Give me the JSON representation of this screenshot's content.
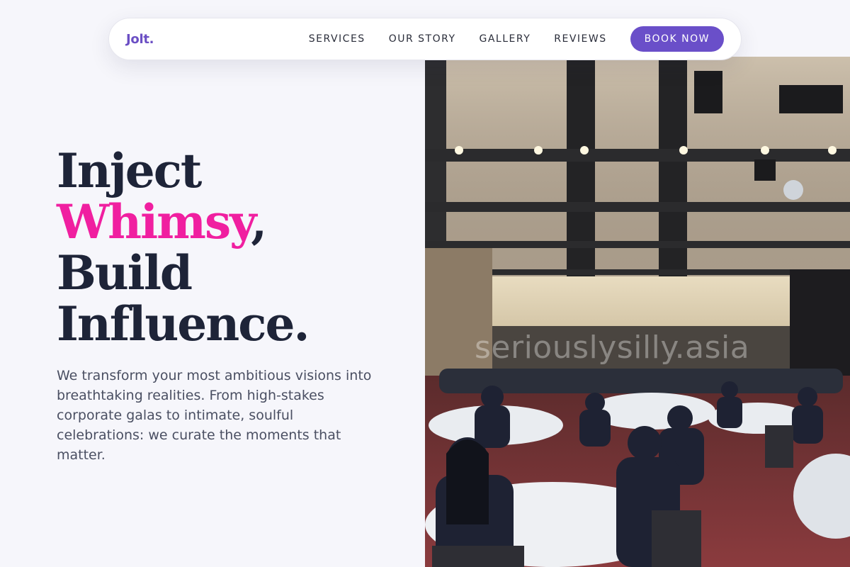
{
  "nav": {
    "brand": "Jolt.",
    "links": [
      "SERVICES",
      "OUR STORY",
      "GALLERY",
      "REVIEWS"
    ],
    "cta": "BOOK NOW"
  },
  "hero": {
    "line1": "Inject",
    "line2_accent": "Whimsy",
    "line2_rest": ",",
    "line3": "Build",
    "line4": "Influence.",
    "description": "We transform your most ambitious visions into breathtaking realities. From high-stakes corporate galas to intimate, soulful celebrations: we curate the moments that matter."
  },
  "photo": {
    "watermark": "seriouslysilly.asia"
  },
  "colors": {
    "brand": "#6b4fc4",
    "accent": "#f01fa0",
    "heading": "#1e2438",
    "button": "#6a4fc9"
  }
}
